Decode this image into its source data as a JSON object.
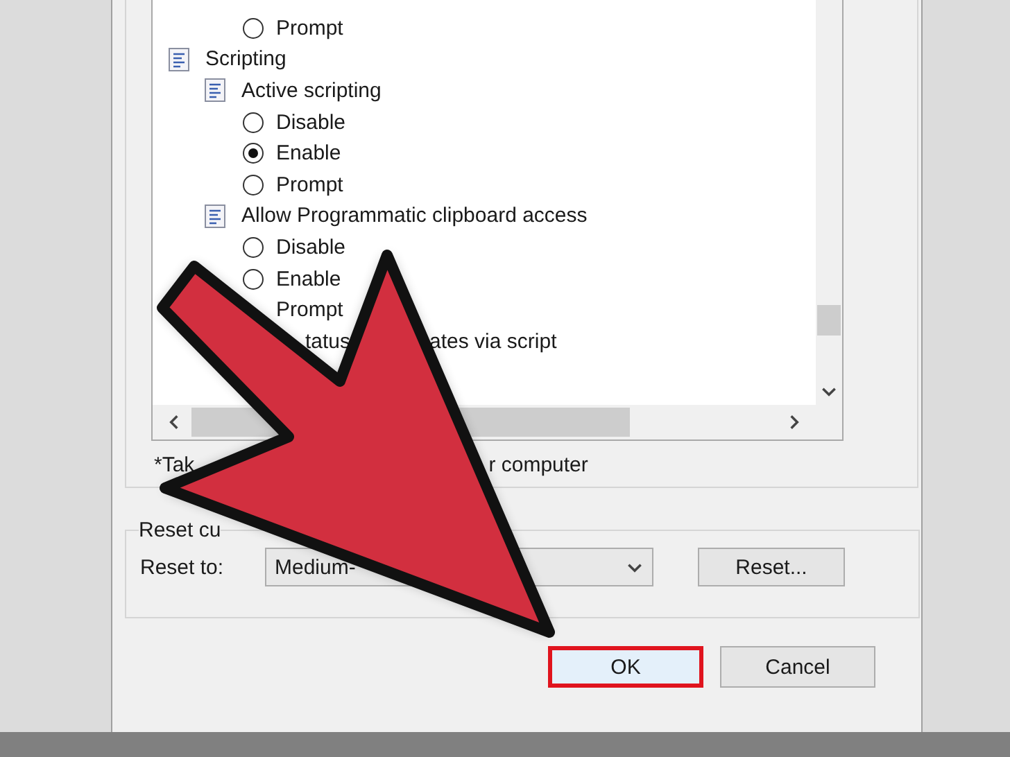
{
  "tree": [
    {
      "kind": "option",
      "label": "Prompt",
      "selected": false
    },
    {
      "kind": "category",
      "label": "Scripting",
      "children": [
        {
          "kind": "setting",
          "label": "Active scripting",
          "children": [
            {
              "kind": "option",
              "label": "Disable",
              "selected": false
            },
            {
              "kind": "option",
              "label": "Enable",
              "selected": true
            },
            {
              "kind": "option",
              "label": "Prompt",
              "selected": false
            }
          ]
        },
        {
          "kind": "setting",
          "label": "Allow Programmatic clipboard access",
          "children": [
            {
              "kind": "option",
              "label": "Disable",
              "selected": false
            },
            {
              "kind": "option",
              "label": "Enable",
              "selected": false
            },
            {
              "kind": "label",
              "label": "Prompt"
            }
          ]
        },
        {
          "kind": "fragments",
          "parts": [
            "tatus",
            "ates via script"
          ]
        }
      ]
    }
  ],
  "note": [
    "*Tak",
    "r computer"
  ],
  "reset_group": {
    "legend": "Reset cu",
    "label": "Reset to:",
    "dropdown_value": "Medium-",
    "button": "Reset..."
  },
  "buttons": [
    {
      "label": "OK",
      "highlighted": true
    },
    {
      "label": "Cancel",
      "highlighted": false
    }
  ]
}
